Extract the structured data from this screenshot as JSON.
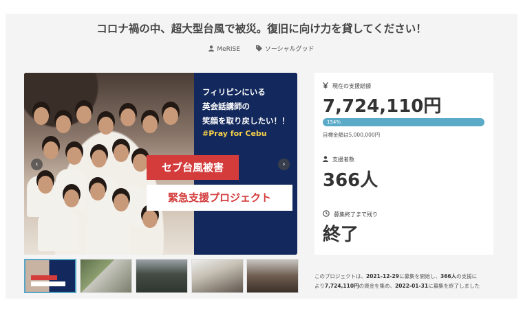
{
  "title": "コロナ禍の中、超大型台風で被災。復旧に向け力を貸してください！",
  "meta": {
    "author": "MeRISE",
    "category": "ソーシャルグッド",
    "icons": [
      "user-icon",
      "tag-icon"
    ]
  },
  "hero": {
    "line1": "フィリピンにいる",
    "line2": "英会話講師の",
    "line3": "笑顔を取り戻したい！！",
    "hashtag": "#Pray for Cebu",
    "banner_red": "セブ台風被害",
    "banner_white": "緊急支援プロジェクト",
    "prev": "‹",
    "next": "›"
  },
  "thumbnails": [
    "project-banner",
    "street-damage",
    "storm-damage",
    "building-damage",
    "group-photo"
  ],
  "stats": {
    "total_label": "現在の支援総額",
    "total_value": "7,724,110円",
    "progress_percent": 154,
    "progress_label": "154%",
    "goal_text": "目標金額は5,000,000円",
    "supporters_label": "支援者数",
    "supporters_value": "366人",
    "remaining_label": "募集終了まで残り",
    "remaining_value": "終了"
  },
  "summary": {
    "p1": "このプロジェクトは、",
    "start_date": "2021-12-29",
    "p2": "に募集を開始し、",
    "supporters": "366人",
    "p3": "の支援に",
    "p4": "より",
    "amount": "7,724,110円",
    "p5": "の資金を集め、",
    "end_date": "2022-01-31",
    "p6": "に募集を終了しました"
  },
  "colors": {
    "accent": "#5aaac8",
    "navy": "#13285c",
    "red": "#d43b3b",
    "highlight": "#f7d14a"
  }
}
